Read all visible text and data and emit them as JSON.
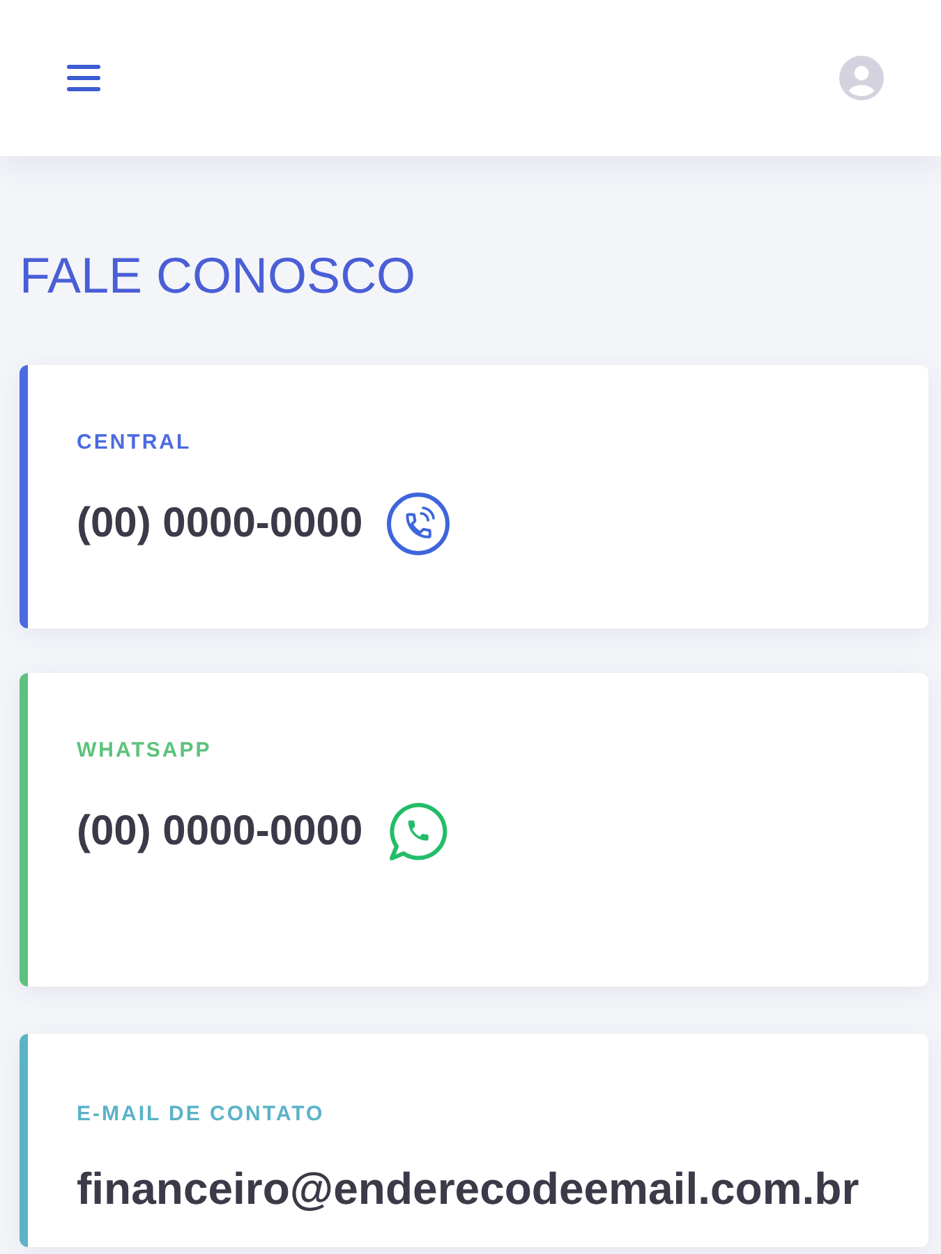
{
  "page_title": "FALE CONOSCO",
  "contacts": [
    {
      "kind": "phone",
      "label": "CENTRAL",
      "value": "(00) 0000-0000",
      "color": "#4a6ae0"
    },
    {
      "kind": "chat",
      "label": "WHATSAPP",
      "value": "(00) 0000-0000",
      "color": "#5dc27c"
    },
    {
      "kind": "email",
      "label": "E-MAIL DE CONTATO",
      "value": "financeiro@enderecodeemail.com.br",
      "color": "#5ab3c8"
    }
  ]
}
